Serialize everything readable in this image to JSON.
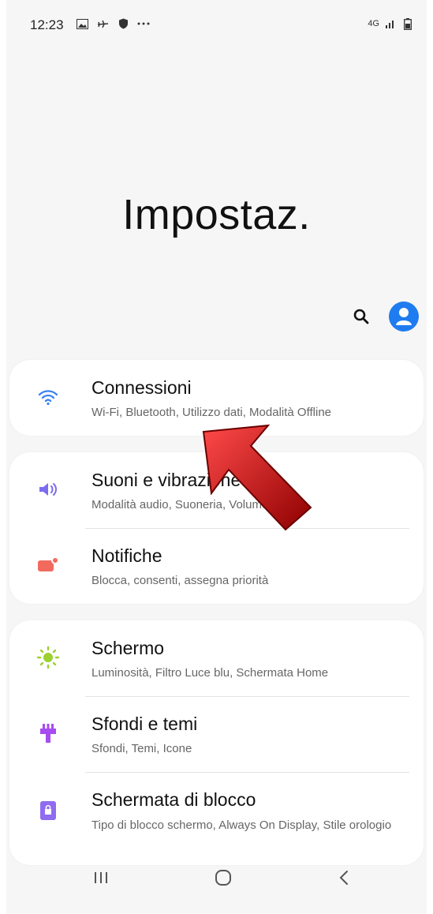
{
  "status_bar": {
    "time": "12:23",
    "left_icons": [
      "gallery-icon",
      "airplane-icon",
      "shield-icon",
      "more-dots-icon"
    ],
    "network": "4G",
    "right_icons": [
      "signal-icon",
      "battery-icon"
    ]
  },
  "header": {
    "title": "Impostaz."
  },
  "toolbar": {
    "icons": [
      "search-icon",
      "account-icon"
    ]
  },
  "groups": [
    {
      "items": [
        {
          "title": "Connessioni",
          "subtitle": "Wi-Fi, Bluetooth, Utilizzo dati, Modalità Offline",
          "icon": "wifi-icon",
          "icon_color": "#3b82f6"
        }
      ]
    },
    {
      "items": [
        {
          "title": "Suoni e vibrazione",
          "subtitle": "Modalità audio, Suoneria, Volume",
          "icon": "volume-icon",
          "icon_color": "#7c6cf0"
        },
        {
          "title": "Notifiche",
          "subtitle": "Blocca, consenti, assegna priorità",
          "icon": "notification-icon",
          "icon_color": "#f26a5e"
        }
      ]
    },
    {
      "items": [
        {
          "title": "Schermo",
          "subtitle": "Luminosità, Filtro Luce blu, Schermata Home",
          "icon": "brightness-icon",
          "icon_color": "#9bd12e"
        },
        {
          "title": "Sfondi e temi",
          "subtitle": "Sfondi, Temi, Icone",
          "icon": "themes-icon",
          "icon_color": "#a64cf0"
        },
        {
          "title": "Schermata di blocco",
          "subtitle": "Tipo di blocco schermo, Always On Display, Stile orologio",
          "icon": "lock-screen-icon",
          "icon_color": "#8f6cf0"
        }
      ]
    }
  ],
  "nav_bar": {
    "buttons": [
      "recents-icon",
      "home-icon",
      "back-icon"
    ]
  },
  "overlay": {
    "arrow_color": "#d40000"
  }
}
